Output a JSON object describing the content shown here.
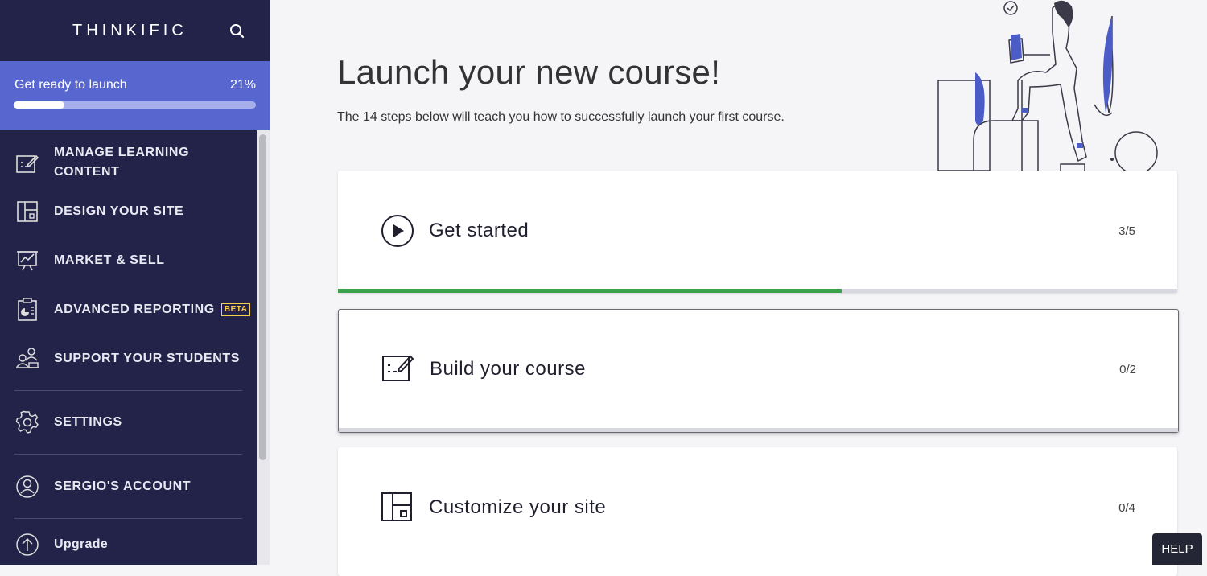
{
  "brand": {
    "logo_text": "THINKIFIC"
  },
  "launch": {
    "label": "Get ready to launch",
    "percent_text": "21%",
    "progress": 0.21
  },
  "nav": [
    {
      "label": "MANAGE LEARNING CONTENT",
      "icon": "edit-board-icon"
    },
    {
      "label": "DESIGN YOUR SITE",
      "icon": "layout-icon"
    },
    {
      "label": "MARKET & SELL",
      "icon": "presentation-chart-icon"
    },
    {
      "label": "ADVANCED REPORTING",
      "badge": "BETA",
      "icon": "report-icon"
    },
    {
      "label": "SUPPORT YOUR STUDENTS",
      "icon": "students-icon"
    },
    {
      "label": "SETTINGS",
      "icon": "gear-icon"
    },
    {
      "label": "SERGIO'S ACCOUNT",
      "icon": "account-icon"
    },
    {
      "label": "Upgrade",
      "icon": "upgrade-arrow-icon"
    }
  ],
  "main": {
    "title": "Launch your new course!",
    "subtitle": "The 14 steps below will teach you how to successfully launch your first course.",
    "steps": [
      {
        "title": "Get started",
        "count": "3/5",
        "progress": 0.6,
        "icon": "play-circle-icon"
      },
      {
        "title": "Build your course",
        "count": "0/2",
        "progress": 0,
        "icon": "edit-board-icon"
      },
      {
        "title": "Customize your site",
        "count": "0/4",
        "progress": 0,
        "icon": "layout-icon"
      }
    ]
  },
  "help": {
    "label": "HELP"
  },
  "colors": {
    "sidebar": "#232248",
    "accent": "#5867cf",
    "progress_green": "#3aa04a",
    "beta": "#f5cf4b"
  }
}
